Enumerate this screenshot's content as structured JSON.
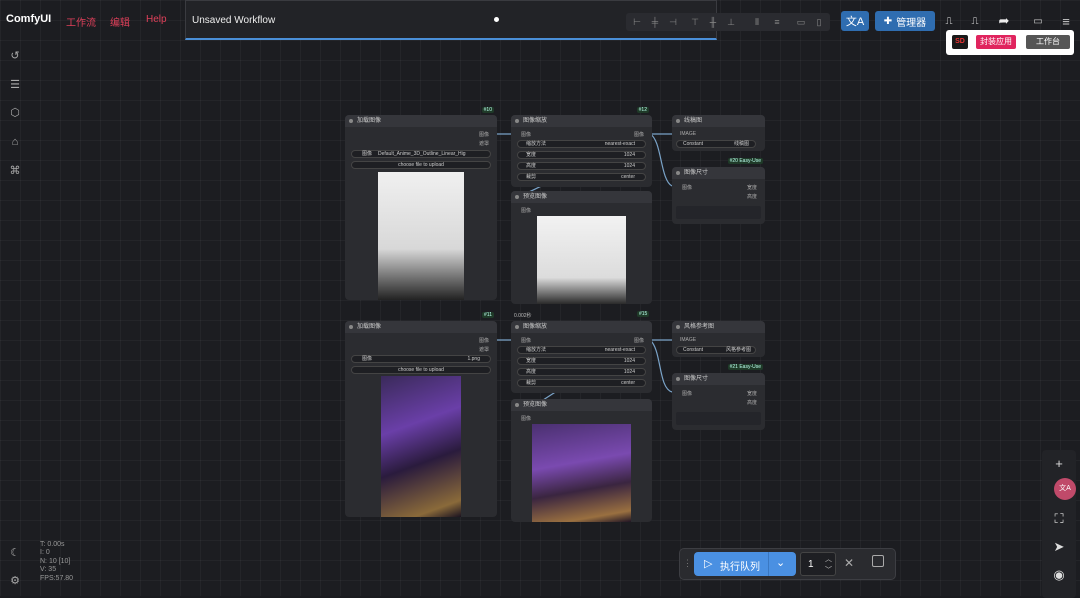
{
  "brand": "ComfyUI",
  "menus": [
    "工作流",
    "编辑",
    "Help"
  ],
  "tab": {
    "title": "Unsaved Workflow"
  },
  "toolbar": {
    "translate_icon": "translate-icon",
    "manager_label": "管理器",
    "popup": {
      "logo": "SD",
      "publish_label": "封装应用",
      "workbench_label": "工作台"
    }
  },
  "stats": {
    "t": "T: 0.00s",
    "i": "I: 0",
    "n": "N: 10 [10]",
    "v": "V: 35",
    "fps": "FPS:57.80"
  },
  "queue": {
    "run_label": "执行队列",
    "count": "1"
  },
  "nodes": {
    "load1": {
      "id": "#10",
      "title": "加载图像",
      "out_image": "图像",
      "out_mask": "遮罩",
      "widget_label": "图像",
      "widget_value": "Default_Anime_3D_Outline_Linear_Hig",
      "upload": "choose file to upload"
    },
    "scale1": {
      "id": "#12",
      "title": "图像缩放",
      "in_image": "图像",
      "out_image": "图像",
      "w1_label": "缩放方法",
      "w1_value": "nearest-exact",
      "w2_label": "宽度",
      "w2_value": "1024",
      "w3_label": "高度",
      "w3_value": "1024",
      "w4_label": "裁剪",
      "w4_value": "center"
    },
    "preview1": {
      "title": "预览图像",
      "in_image": "图像",
      "time": "0.002秒",
      "next_id": "#15"
    },
    "lineart": {
      "title": "线稿图",
      "in_label": "IMAGE",
      "widget_label": "Constant",
      "widget_value": "线稿图"
    },
    "size1": {
      "id": "#20 Easy-Use",
      "title": "图像尺寸",
      "in_image": "图像",
      "out_w": "宽度",
      "out_h": "高度"
    },
    "load2": {
      "id": "#11",
      "title": "加载图像",
      "out_image": "图像",
      "out_mask": "遮罩",
      "widget_label": "图像",
      "widget_value": "1.png",
      "upload": "choose file to upload"
    },
    "scale2": {
      "title": "图像缩放",
      "in_image": "图像",
      "out_image": "图像",
      "w1_label": "缩放方法",
      "w1_value": "nearest-exact",
      "w2_label": "宽度",
      "w2_value": "1024",
      "w3_label": "高度",
      "w3_value": "1024",
      "w4_label": "裁剪",
      "w4_value": "center"
    },
    "preview2": {
      "title": "预览图像",
      "in_image": "图像"
    },
    "style": {
      "title": "风格参考图",
      "in_label": "IMAGE",
      "widget_label": "Constant",
      "widget_value": "风格参考图"
    },
    "size2": {
      "id": "#21 Easy-Use",
      "title": "图像尺寸",
      "in_image": "图像",
      "out_w": "宽度",
      "out_h": "高度"
    }
  }
}
